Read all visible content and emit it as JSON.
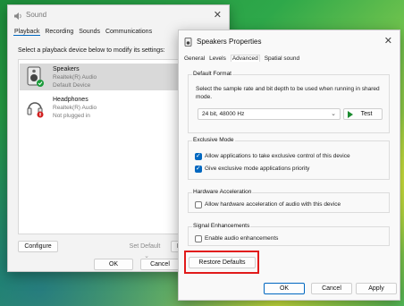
{
  "sound_window": {
    "title": "Sound",
    "tabs": [
      "Playback",
      "Recording",
      "Sounds",
      "Communications"
    ],
    "instruction": "Select a playback device below to modify its settings:",
    "devices": [
      {
        "name": "Speakers",
        "driver": "Realtek(R) Audio",
        "status": "Default Device",
        "selected": true
      },
      {
        "name": "Headphones",
        "driver": "Realtek(R) Audio",
        "status": "Not plugged in",
        "selected": false
      }
    ],
    "configure_label": "Configure",
    "set_default_label": "Set Default",
    "properties_label": "Pr",
    "ok_label": "OK",
    "cancel_label": "Cancel",
    "close_glyph": "✕"
  },
  "props_window": {
    "title": "Speakers Properties",
    "tabs": [
      "General",
      "Levels",
      "Advanced",
      "Spatial sound"
    ],
    "active_tab": "Advanced",
    "default_format": {
      "label": "Default Format",
      "description": "Select the sample rate and bit depth to be used when running in shared mode.",
      "selected": "24 bit, 48000 Hz",
      "test_label": "Test"
    },
    "exclusive": {
      "label": "Exclusive Mode",
      "opt1": "Allow applications to take exclusive control of this device",
      "opt1_checked": true,
      "opt2": "Give exclusive mode applications priority",
      "opt2_checked": true
    },
    "hw_accel": {
      "label": "Hardware Acceleration",
      "opt": "Allow hardware acceleration of audio with this device",
      "opt_checked": false
    },
    "signal": {
      "label": "Signal Enhancements",
      "opt": "Enable audio enhancements",
      "opt_checked": false
    },
    "restore_label": "Restore Defaults",
    "ok_label": "OK",
    "cancel_label": "Cancel",
    "apply_label": "Apply",
    "close_glyph": "✕"
  },
  "colors": {
    "accent": "#0067c0",
    "highlight": "#e11b1b",
    "test_play": "#1a8a2e"
  }
}
